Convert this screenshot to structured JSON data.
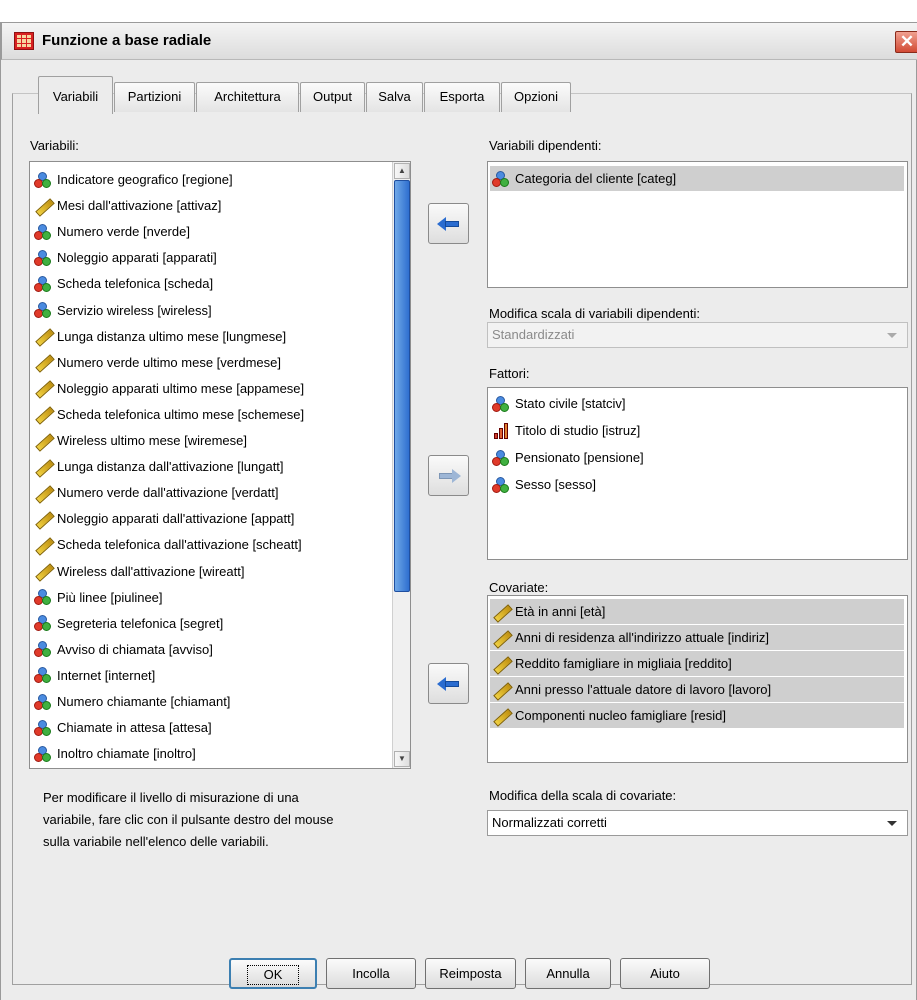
{
  "window": {
    "title": "Funzione a base radiale",
    "close_symbol": "✕"
  },
  "tabs": [
    {
      "label": "Variabili",
      "active": true
    },
    {
      "label": "Partizioni",
      "active": false
    },
    {
      "label": "Architettura",
      "active": false
    },
    {
      "label": "Output",
      "active": false
    },
    {
      "label": "Salva",
      "active": false
    },
    {
      "label": "Esporta",
      "active": false
    },
    {
      "label": "Opzioni",
      "active": false
    }
  ],
  "variables": {
    "label": "Variabili:",
    "items": [
      {
        "label": "Indicatore geografico [regione]",
        "icon": "nominal-icon"
      },
      {
        "label": "Mesi dall'attivazione [attivaz]",
        "icon": "scale-icon"
      },
      {
        "label": "Numero verde [nverde]",
        "icon": "nominal-icon"
      },
      {
        "label": "Noleggio apparati [apparati]",
        "icon": "nominal-icon"
      },
      {
        "label": "Scheda telefonica [scheda]",
        "icon": "nominal-icon"
      },
      {
        "label": "Servizio wireless [wireless]",
        "icon": "nominal-icon"
      },
      {
        "label": "Lunga distanza ultimo mese [lungmese]",
        "icon": "scale-icon"
      },
      {
        "label": "Numero verde ultimo mese [verdmese]",
        "icon": "scale-icon"
      },
      {
        "label": "Noleggio apparati ultimo mese [appamese]",
        "icon": "scale-icon"
      },
      {
        "label": "Scheda telefonica ultimo mese [schemese]",
        "icon": "scale-icon"
      },
      {
        "label": "Wireless ultimo mese [wiremese]",
        "icon": "scale-icon"
      },
      {
        "label": "Lunga distanza dall'attivazione [lungatt]",
        "icon": "scale-icon"
      },
      {
        "label": "Numero verde dall'attivazione [verdatt]",
        "icon": "scale-icon"
      },
      {
        "label": "Noleggio apparati dall'attivazione [appatt]",
        "icon": "scale-icon"
      },
      {
        "label": "Scheda telefonica dall'attivazione [scheatt]",
        "icon": "scale-icon"
      },
      {
        "label": "Wireless dall'attivazione [wireatt]",
        "icon": "scale-icon"
      },
      {
        "label": "Più linee [piulinee]",
        "icon": "nominal-icon"
      },
      {
        "label": "Segreteria telefonica [segret]",
        "icon": "nominal-icon"
      },
      {
        "label": "Avviso di chiamata [avviso]",
        "icon": "nominal-icon"
      },
      {
        "label": "Internet [internet]",
        "icon": "nominal-icon"
      },
      {
        "label": "Numero chiamante [chiamant]",
        "icon": "nominal-icon"
      },
      {
        "label": "Chiamate in attesa [attesa]",
        "icon": "nominal-icon"
      },
      {
        "label": "Inoltro chiamate [inoltro]",
        "icon": "nominal-icon"
      }
    ]
  },
  "dependent": {
    "label": "Variabili dipendenti:",
    "items": [
      {
        "label": "Categoria del cliente [categ]",
        "icon": "nominal-icon"
      }
    ]
  },
  "rescale_dependent": {
    "label": "Modifica scala di variabili dipendenti:",
    "value": "Standardizzati"
  },
  "factors": {
    "label": "Fattori:",
    "items": [
      {
        "label": "Stato civile [statciv]",
        "icon": "nominal-icon"
      },
      {
        "label": "Titolo di studio [istruz]",
        "icon": "ordinal-icon"
      },
      {
        "label": "Pensionato [pensione]",
        "icon": "nominal-icon"
      },
      {
        "label": "Sesso [sesso]",
        "icon": "nominal-icon"
      }
    ]
  },
  "covariates": {
    "label": "Covariate:",
    "items": [
      {
        "label": "Età in anni [età]",
        "icon": "scale-icon"
      },
      {
        "label": "Anni di residenza all'indirizzo attuale [indiriz]",
        "icon": "scale-icon"
      },
      {
        "label": "Reddito famigliare in migliaia [reddito]",
        "icon": "scale-icon"
      },
      {
        "label": "Anni presso l'attuale datore di lavoro [lavoro]",
        "icon": "scale-icon"
      },
      {
        "label": "Componenti nucleo famigliare [resid]",
        "icon": "scale-icon"
      }
    ]
  },
  "rescale_covariates": {
    "label": "Modifica della scala di covariate:",
    "value": "Normalizzati corretti"
  },
  "hint": [
    "Per modificare il livello di misurazione di una",
    "variabile, fare clic con il pulsante destro del mouse",
    "sulla variabile nell'elenco delle variabili."
  ],
  "buttons": {
    "ok": "OK",
    "paste": "Incolla",
    "reset": "Reimposta",
    "cancel": "Annulla",
    "help": "Aiuto"
  }
}
